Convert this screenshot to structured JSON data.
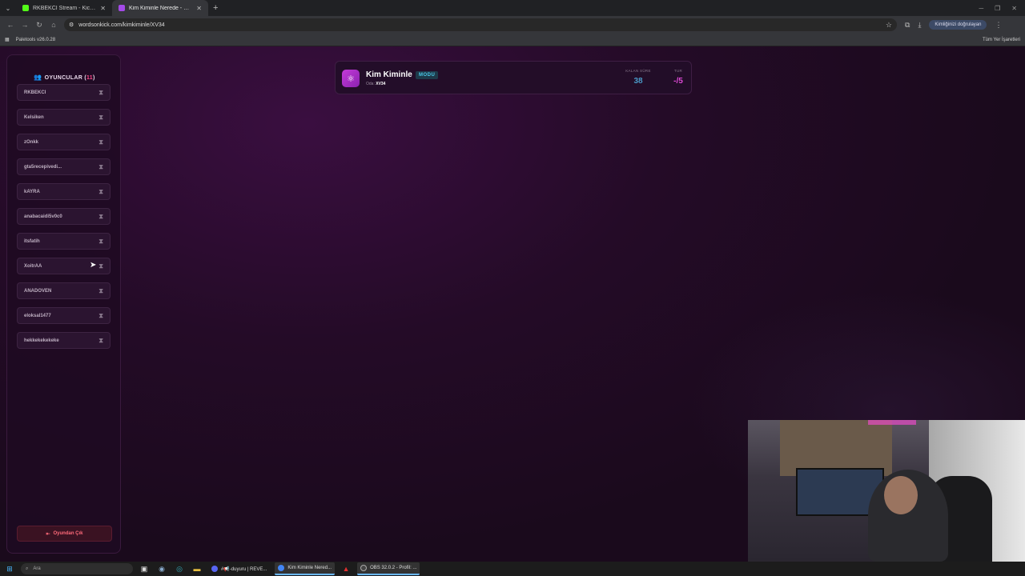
{
  "browser": {
    "tabs": [
      {
        "label": "RKBEKCI Stream - Kick Dashboa",
        "color": "#53fc18",
        "active": false
      },
      {
        "label": "Kim Kiminle Nerede - Words O",
        "color": "#a44ae8",
        "active": true
      }
    ],
    "url": "wordsonkick.com/kimkiminle/XV34",
    "profile_label": "Kimliğinizi doğrulayan",
    "bookmark": "Paletools v26.0.28",
    "all_bookmarks": "Tüm Yer İşaretleri"
  },
  "sidebar": {
    "title": "OYUNCULAR",
    "count": "11",
    "players": [
      "RKBEKCI",
      "Kelsiken",
      "zOnkk",
      "gta5recepivedi...",
      "kAYRA",
      "anabacaidi5v0c0",
      "itsfatih",
      "XoitrAA",
      "ANADOVEN",
      "eloksal1477",
      "hekkekekekeke"
    ],
    "leave_label": "Oyundan Çık"
  },
  "header": {
    "title": "Kim Kiminle",
    "mode_badge": "MODU",
    "room_label": "Oda:",
    "room_code": "XV34",
    "remaining_label": "KALAN SÜRE",
    "remaining_value": "38",
    "round_label": "TUR",
    "round_value": "-/5"
  },
  "colors": {
    "accent": "#c43ad8",
    "timer": "#4a9ac8",
    "round": "#e04ad8"
  },
  "taskbar": {
    "search_placeholder": "Ara",
    "items": [
      {
        "label": "#📢-duyuru | REVE...",
        "color": "#5865f2"
      },
      {
        "label": "Kim Kiminle Nered...",
        "color": "#4285f4"
      },
      {
        "label": "OBS 32.0.2 - Profil: ...",
        "color": "#444"
      }
    ]
  }
}
